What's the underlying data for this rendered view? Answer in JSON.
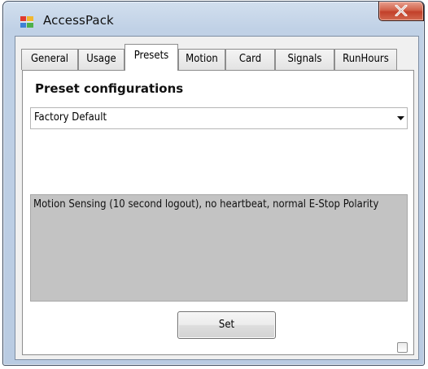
{
  "window": {
    "title": "AccessPack",
    "icon": "app-icon",
    "close_glyph": "close-icon"
  },
  "tabs": [
    {
      "label": "General",
      "active": false
    },
    {
      "label": "Usage",
      "active": false
    },
    {
      "label": "Presets",
      "active": true
    },
    {
      "label": "Motion",
      "active": false
    },
    {
      "label": "Card",
      "active": false
    },
    {
      "label": "Signals",
      "active": false
    },
    {
      "label": "RunHours",
      "active": false
    }
  ],
  "presets": {
    "heading": "Preset configurations",
    "selected": "Factory Default",
    "description": "Motion Sensing (10 second logout), no heartbeat, normal E-Stop Polarity",
    "set_label": "Set"
  },
  "colors": {
    "title_bar": "#c0d1e6",
    "close_button": "#c94a32",
    "description_bg": "#c3c3c3"
  }
}
